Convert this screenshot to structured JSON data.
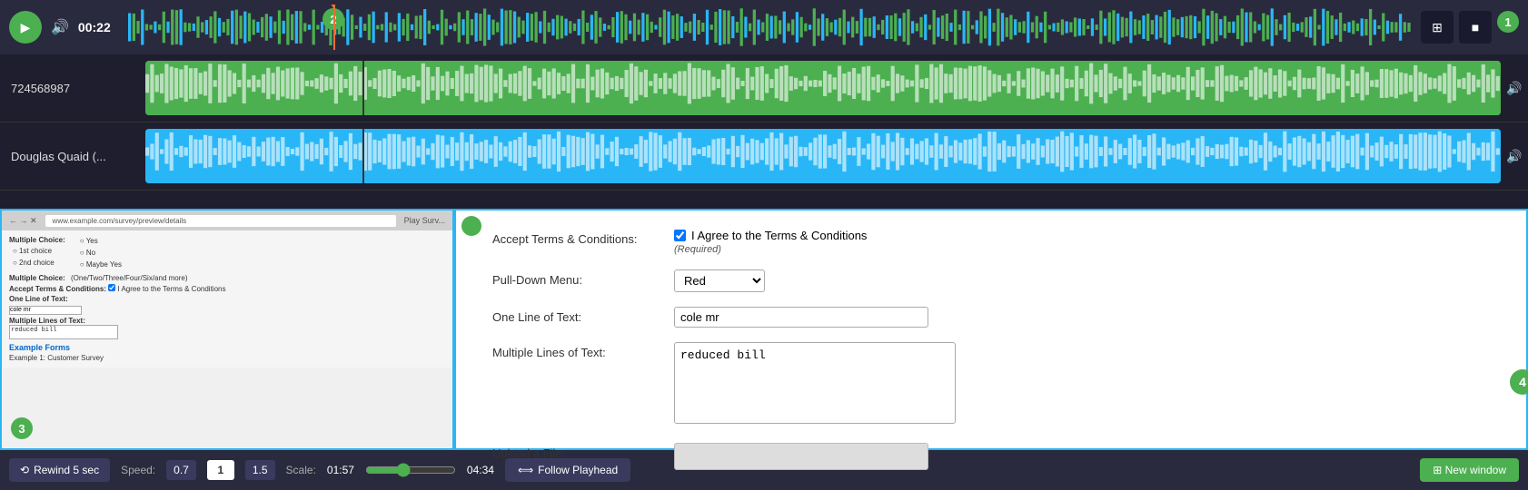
{
  "toolbar": {
    "play_label": "▶",
    "time": "00:22",
    "volume_icon": "🔊"
  },
  "tracks": [
    {
      "id": "724568987",
      "label": "724568987",
      "color": "green"
    },
    {
      "id": "douglas-quaid",
      "label": "Douglas Quaid (...",
      "color": "blue"
    }
  ],
  "badges": {
    "b1": "1",
    "b2": "2",
    "b3": "3",
    "b4": "4"
  },
  "form": {
    "accept_terms_label": "Accept Terms & Conditions:",
    "accept_terms_checkbox": "I Agree to the Terms & Conditions",
    "required_text": "(Required)",
    "pulldown_label": "Pull-Down Menu:",
    "pulldown_value": "Red",
    "one_line_label": "One Line of Text:",
    "one_line_value": "cole mr",
    "multi_line_label": "Multiple Lines of Text:",
    "multi_line_value": "reduced bill",
    "upload_label": "Upload a File:",
    "example_forms": "Example Forms",
    "example_1": "Example 1: Customer Survey"
  },
  "bottom_bar": {
    "rewind_label": "⟲ Rewind 5 sec",
    "speed_label": "Speed:",
    "speed_0_7": "0.7",
    "speed_1": "1",
    "speed_1_5": "1.5",
    "scale_label": "Scale:",
    "scale_start": "01:57",
    "scale_end": "04:34",
    "follow_label": "⟺ Follow Playhead",
    "new_window_label": "⊞ New window"
  },
  "icons": {
    "grid_icon": "⊞",
    "stop_icon": "■",
    "volume_icon": "🔊"
  }
}
